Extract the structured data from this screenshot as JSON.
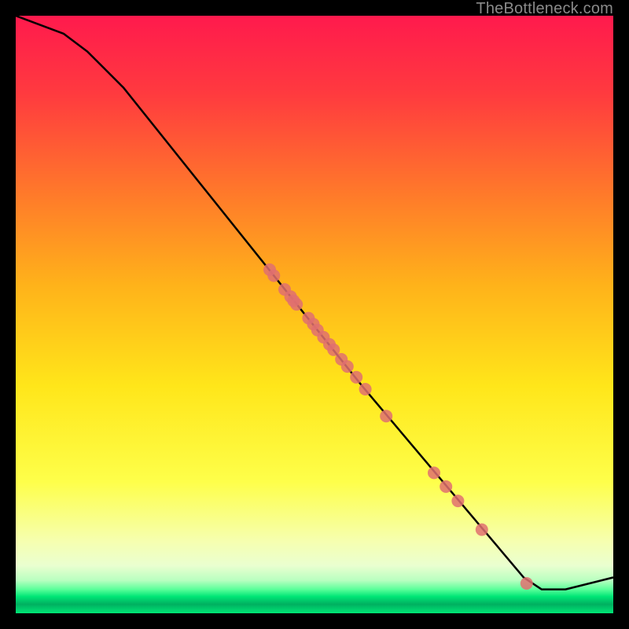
{
  "watermark": "TheBottleneck.com",
  "colors": {
    "bg": "#000000",
    "curve": "#000000",
    "marker": "#e07070",
    "grad_top": "#ff1a4d",
    "grad_mid1": "#ff9b1a",
    "grad_mid2": "#ffe61a",
    "grad_mid3": "#f8ff8a",
    "grad_green": "#00e676"
  },
  "chart_data": {
    "type": "line",
    "title": "",
    "xlabel": "",
    "ylabel": "",
    "xlim": [
      0,
      100
    ],
    "ylim": [
      0,
      100
    ],
    "series": [
      {
        "name": "curve",
        "x": [
          0,
          8,
          12,
          18,
          50,
          58,
          85,
          88,
          92,
          100
        ],
        "y": [
          100,
          97,
          94,
          88,
          48,
          38,
          6,
          4,
          4,
          6
        ]
      }
    ],
    "markers": {
      "name": "points",
      "x": [
        42.5,
        43.2,
        45.0,
        46.0,
        46.5,
        47.0,
        49.0,
        49.8,
        50.5,
        51.5,
        52.5,
        53.2,
        54.5,
        55.5,
        57.0,
        58.5,
        62.0,
        70.0,
        72.0,
        74.0,
        78.0,
        85.5
      ],
      "y": [
        57.5,
        56.5,
        54.2,
        53.0,
        52.3,
        51.7,
        49.4,
        48.4,
        47.4,
        46.2,
        45.0,
        44.1,
        42.5,
        41.3,
        39.5,
        37.5,
        33.0,
        23.5,
        21.2,
        18.8,
        14.0,
        5.0
      ]
    }
  }
}
